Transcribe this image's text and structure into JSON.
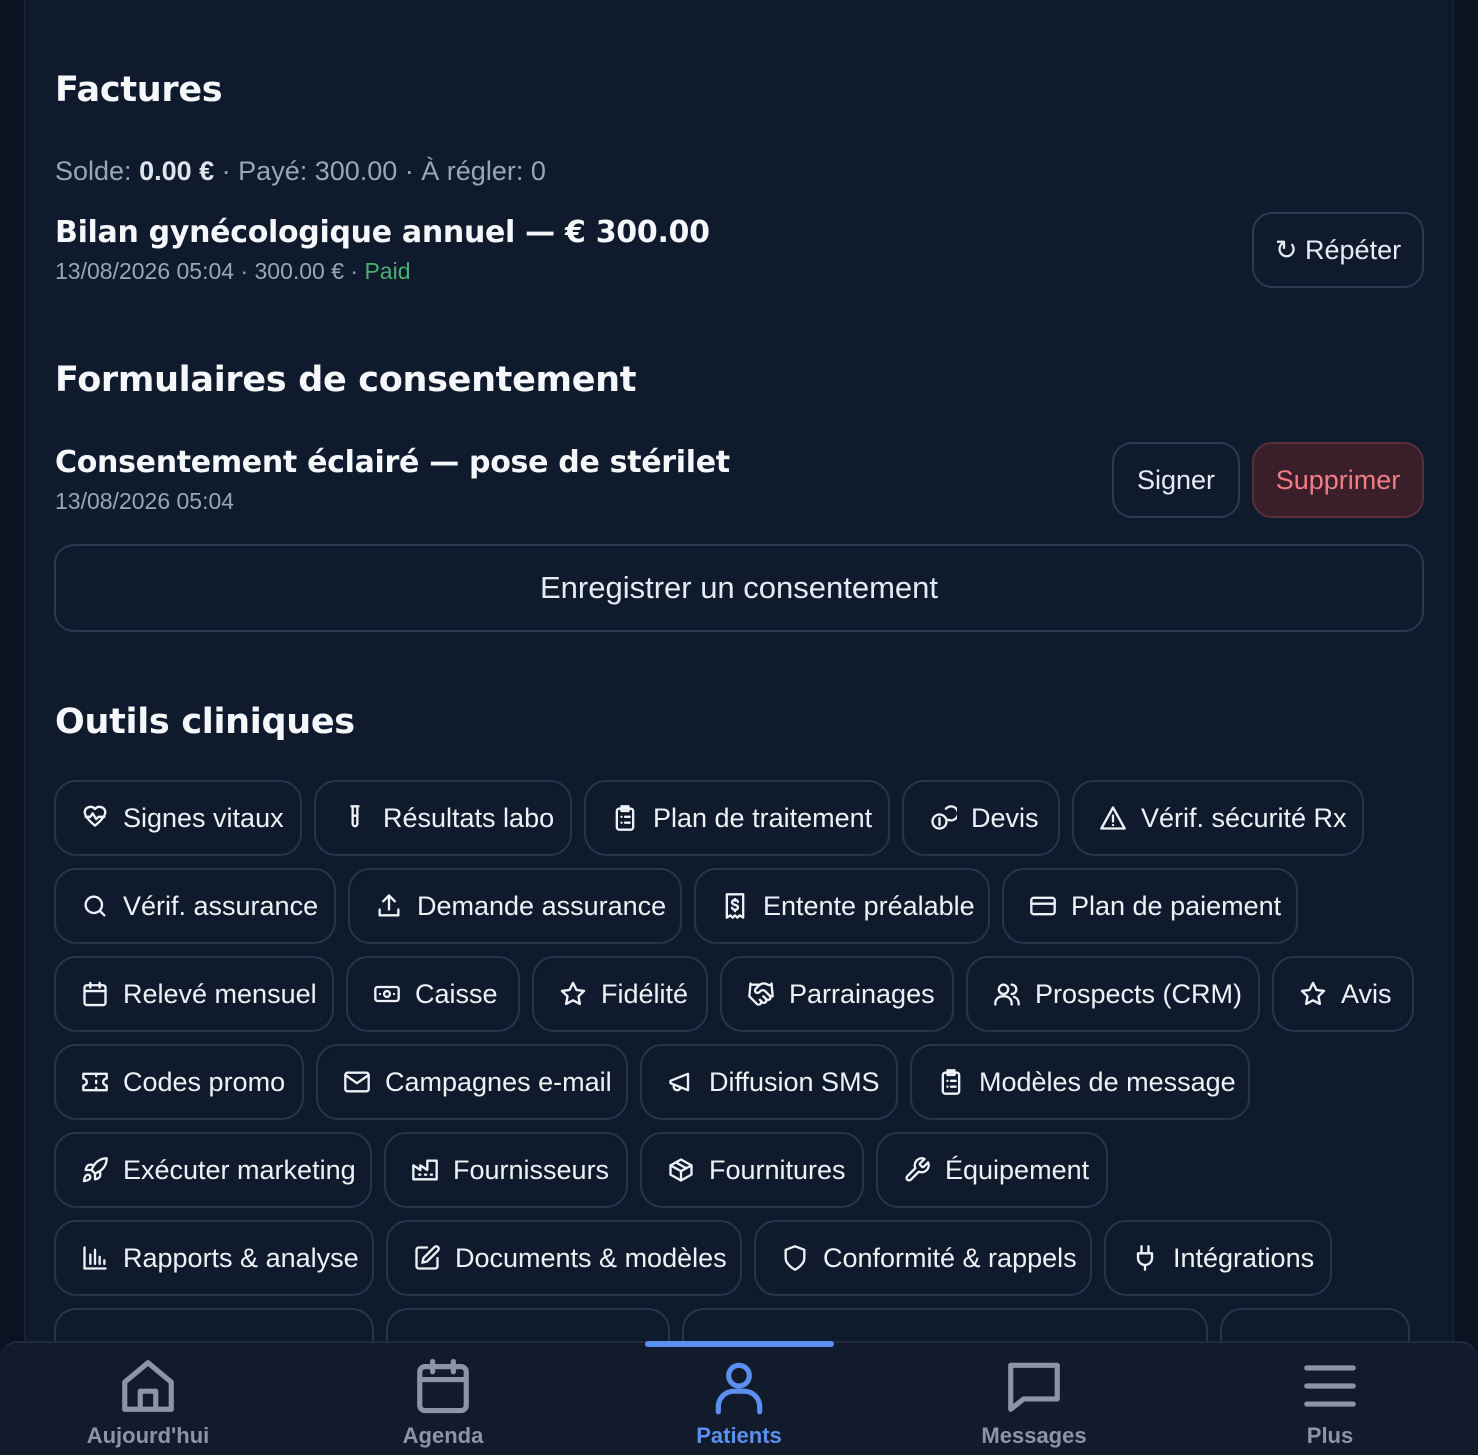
{
  "invoices": {
    "title": "Factures",
    "summary": {
      "balance_label": "Solde:",
      "balance_value": "0.00 €",
      "rest": "· Payé: 300.00 · À régler: 0"
    },
    "item": {
      "title": "Bilan gynécologique annuel — € 300.00",
      "meta": "13/08/2026 05:04 · 300.00 € ·",
      "status": "Paid",
      "repeat_label": "↻ Répéter"
    }
  },
  "consents": {
    "title": "Formulaires de consentement",
    "item": {
      "title": "Consentement éclairé — pose de stérilet",
      "meta": "13/08/2026 05:04",
      "sign_label": "Signer",
      "delete_label": "Supprimer"
    },
    "record_label": "Enregistrer un consentement"
  },
  "tools": {
    "title": "Outils cliniques",
    "items": [
      {
        "label": "Signes vitaux",
        "icon": "heart-pulse-icon"
      },
      {
        "label": "Résultats labo",
        "icon": "test-tube-icon"
      },
      {
        "label": "Plan de traitement",
        "icon": "clipboard-list-icon"
      },
      {
        "label": "Devis",
        "icon": "coins-icon"
      },
      {
        "label": "Vérif. sécurité Rx",
        "icon": "alert-triangle-icon"
      },
      {
        "label": "Vérif. assurance",
        "icon": "search-icon"
      },
      {
        "label": "Demande assurance",
        "icon": "upload-icon"
      },
      {
        "label": "Entente préalable",
        "icon": "receipt-icon"
      },
      {
        "label": "Plan de paiement",
        "icon": "credit-card-icon"
      },
      {
        "label": "Relevé mensuel",
        "icon": "calendar-icon"
      },
      {
        "label": "Caisse",
        "icon": "banknote-icon"
      },
      {
        "label": "Fidélité",
        "icon": "star-icon"
      },
      {
        "label": "Parrainages",
        "icon": "handshake-icon"
      },
      {
        "label": "Prospects (CRM)",
        "icon": "users-icon"
      },
      {
        "label": "Avis",
        "icon": "star-icon"
      },
      {
        "label": "Codes promo",
        "icon": "ticket-icon"
      },
      {
        "label": "Campagnes e-mail",
        "icon": "mail-icon"
      },
      {
        "label": "Diffusion SMS",
        "icon": "megaphone-icon"
      },
      {
        "label": "Modèles de message",
        "icon": "clipboard-list-icon"
      },
      {
        "label": "Exécuter marketing",
        "icon": "rocket-icon"
      },
      {
        "label": "Fournisseurs",
        "icon": "factory-icon"
      },
      {
        "label": "Fournitures",
        "icon": "package-icon"
      },
      {
        "label": "Équipement",
        "icon": "wrench-icon"
      },
      {
        "label": "Rapports & analyse",
        "icon": "bar-chart-icon"
      },
      {
        "label": "Documents & modèles",
        "icon": "edit-icon"
      },
      {
        "label": "Conformité & rappels",
        "icon": "shield-icon"
      },
      {
        "label": "Intégrations",
        "icon": "plug-icon"
      }
    ]
  },
  "nav": {
    "items": [
      {
        "label": "Aujourd'hui",
        "icon": "home-icon"
      },
      {
        "label": "Agenda",
        "icon": "calendar-icon"
      },
      {
        "label": "Patients",
        "icon": "user-icon",
        "active": true
      },
      {
        "label": "Messages",
        "icon": "message-icon"
      },
      {
        "label": "Plus",
        "icon": "menu-icon"
      }
    ]
  },
  "colors": {
    "accent": "#5b8ff0",
    "paid": "#4caf6f",
    "danger": "#f07c84",
    "background": "#0f1a2d"
  }
}
